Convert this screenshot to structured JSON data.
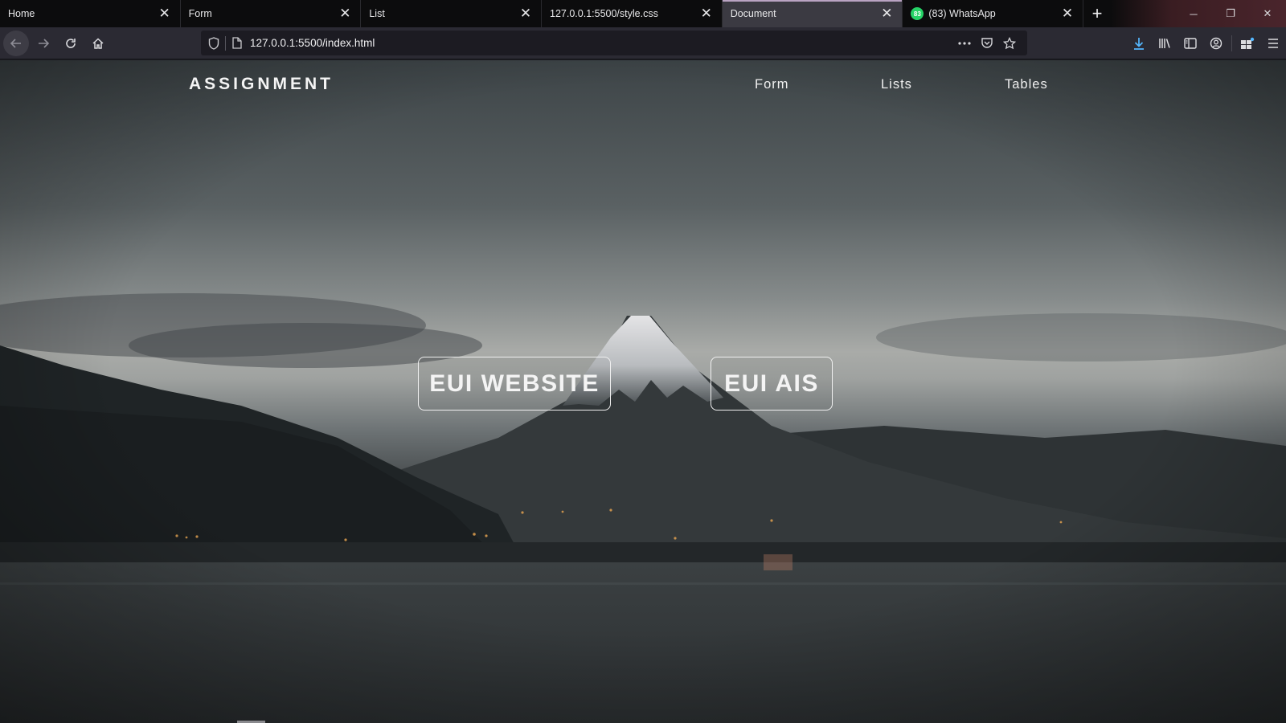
{
  "browser": {
    "tabs": [
      {
        "title": "Home",
        "active": false
      },
      {
        "title": "Form",
        "active": false
      },
      {
        "title": "List",
        "active": false
      },
      {
        "title": "127.0.0.1:5500/style.css",
        "active": false
      },
      {
        "title": "Document",
        "active": true
      },
      {
        "title": "(83) WhatsApp",
        "active": false,
        "favicon": "whatsapp-icon",
        "favicon_text": "83"
      }
    ],
    "close_glyph": "✕",
    "new_tab_glyph": "+",
    "window_controls": {
      "minimize": "─",
      "restore": "❐",
      "close": "✕"
    },
    "url": "127.0.0.1:5500/index.html",
    "accent_color": "#b9a3c2",
    "download_color": "#54b7ff"
  },
  "site": {
    "brand": "ASSIGNMENT",
    "nav": {
      "form": "Form",
      "lists": "Lists",
      "tables": "Tables"
    },
    "buttons": {
      "website": "EUI WEBSITE",
      "ais": "EUI AIS"
    },
    "background": "mountain-lake-dusk-photo"
  }
}
